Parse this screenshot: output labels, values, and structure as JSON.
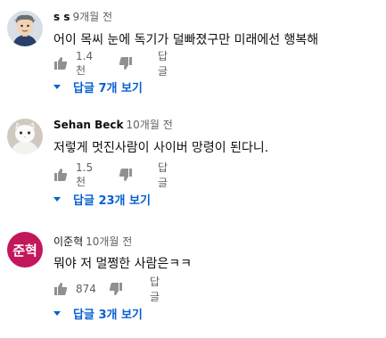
{
  "comments": [
    {
      "author": "s s",
      "time": "9개월 전",
      "text": "어이 목씨 눈에 독기가 덜빠졌구만 미래에선 행복해",
      "likes": "1.4천",
      "reply_label": "답글",
      "replies_label": "답글 7개 보기",
      "avatar_icon": "cartoon-person-avatar"
    },
    {
      "author": "Sehan Beck",
      "time": "10개월 전",
      "text": "저렇게 멋진사람이 사이버 망령이 된다니.",
      "likes": "1.5천",
      "reply_label": "답글",
      "replies_label": "답글 23개 보기",
      "avatar_icon": "white-cat-avatar"
    },
    {
      "author": "이준혁",
      "time": "10개월 전",
      "text": "뭐야 저 멀쩡한 사람은ㅋㅋ",
      "likes": "874",
      "reply_label": "답글",
      "replies_label": "답글 3개 보기",
      "avatar_letter": "준혁",
      "avatar_color": "#c2185b"
    }
  ],
  "colors": {
    "link": "#065fd4",
    "secondary_text": "#606060",
    "icon": "#909090"
  }
}
